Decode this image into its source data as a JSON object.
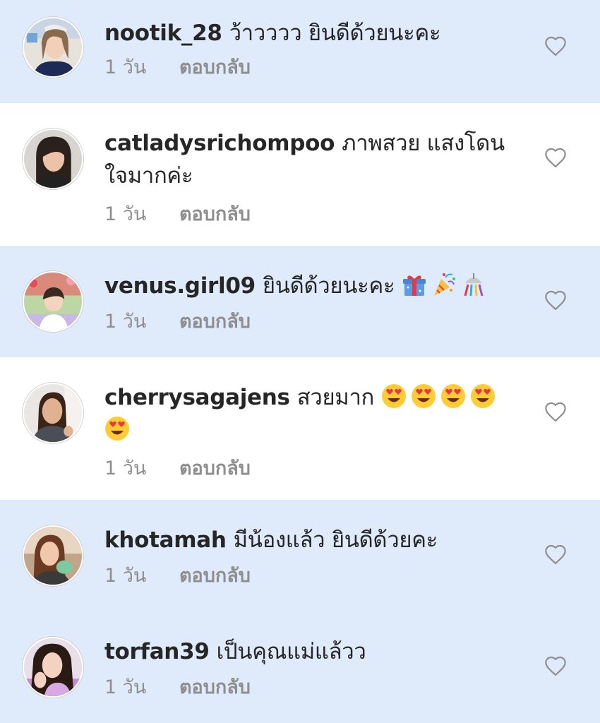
{
  "comments": [
    {
      "username": "nootik_28",
      "text": "ว้าวววว ยินดีด้วยนะคะ",
      "time": "1 วัน",
      "reply": "ตอบกลับ",
      "highlighted": true,
      "emojis": []
    },
    {
      "username": "catladysrichompoo",
      "text": "ภาพสวย แสงโดนใจมากค่ะ",
      "time": "1 วัน",
      "reply": "ตอบกลับ",
      "highlighted": false,
      "emojis": []
    },
    {
      "username": "venus.girl09",
      "text": "ยินดีด้วยนะคะ",
      "time": "1 วัน",
      "reply": "ตอบกลับ",
      "highlighted": true,
      "emojis": [
        "gift-emoji",
        "party-popper-emoji",
        "confetti-ball-emoji"
      ]
    },
    {
      "username": "cherrysagajens",
      "text": "สวยมาก",
      "time": "1 วัน",
      "reply": "ตอบกลับ",
      "highlighted": false,
      "emojis": [
        "heart-eyes-emoji",
        "heart-eyes-emoji",
        "heart-eyes-emoji",
        "heart-eyes-emoji",
        "heart-eyes-emoji"
      ]
    },
    {
      "username": "khotamah",
      "text": "มีน้องแล้ว ยินดีด้วยคะ",
      "time": "1 วัน",
      "reply": "ตอบกลับ",
      "highlighted": true,
      "emojis": []
    },
    {
      "username": "torfan39",
      "text": "เป็นคุณแม่แล้วว",
      "time": "1 วัน",
      "reply": "ตอบกลับ",
      "highlighted": true,
      "emojis": []
    }
  ],
  "colors": {
    "highlight_background": "#dfeafb",
    "plain_background": "#ffffff",
    "username": "#262626",
    "meta_text": "#8e8e8e",
    "heart_outline": "#8e8e8e"
  },
  "icons": {
    "like": "heart-outline-icon",
    "avatar": "profile-photo"
  }
}
